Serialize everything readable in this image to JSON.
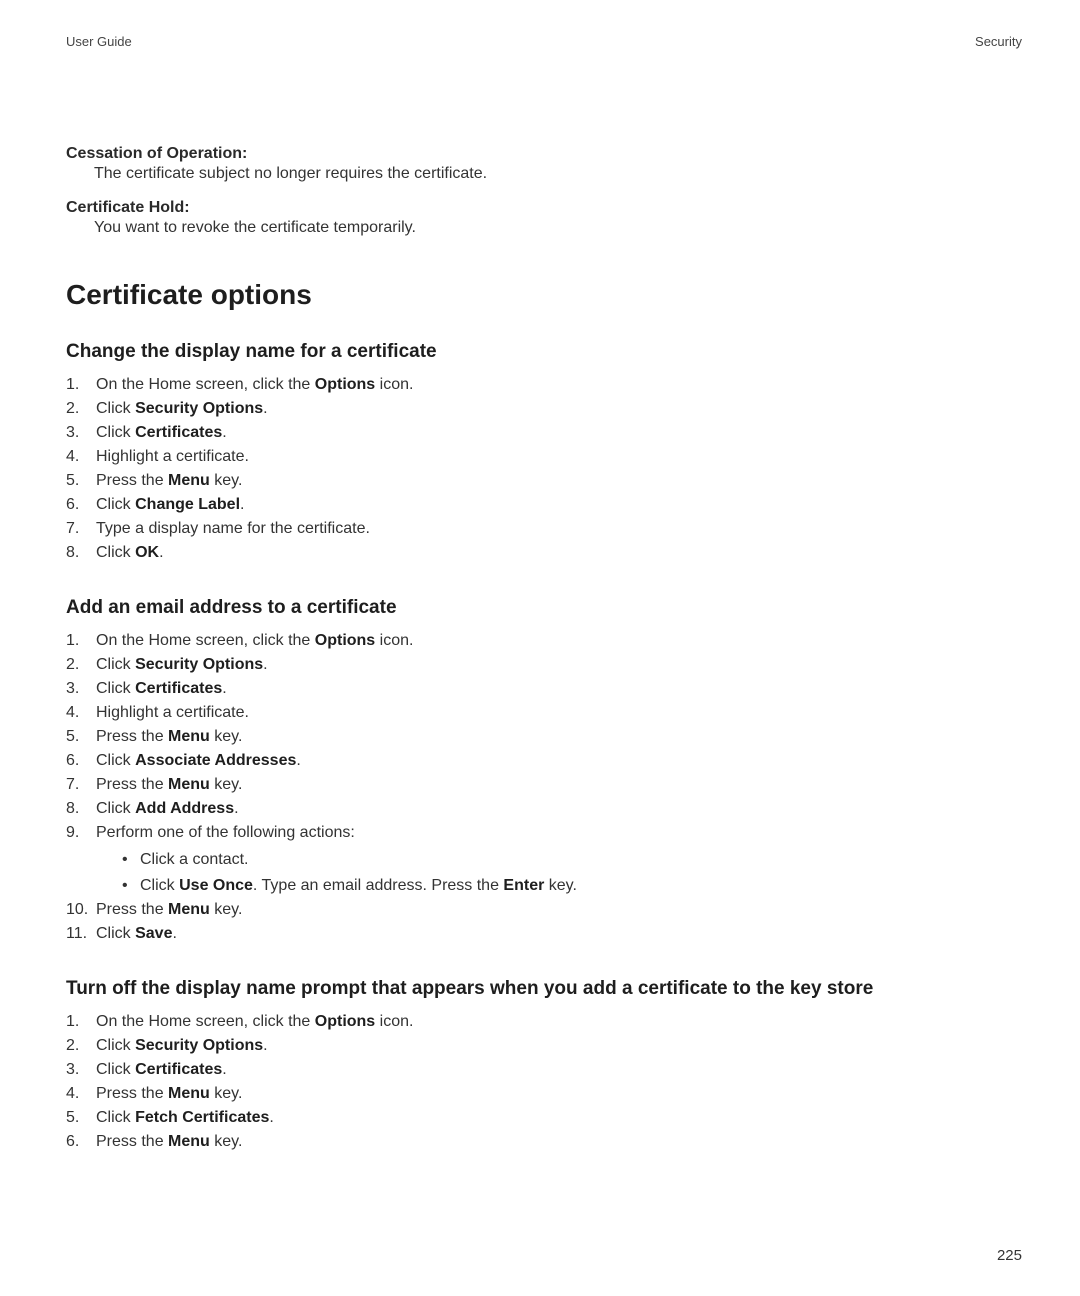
{
  "header": {
    "left": "User Guide",
    "right": "Security"
  },
  "definitions": [
    {
      "term": "Cessation of Operation:",
      "desc": "The certificate subject no longer requires the certificate."
    },
    {
      "term": "Certificate Hold:",
      "desc": "You want to revoke the certificate temporarily."
    }
  ],
  "section_title": "Certificate options",
  "subsections": [
    {
      "title": "Change the display name for a certificate",
      "steps": [
        [
          {
            "t": "plain",
            "v": "On the Home screen, click the "
          },
          {
            "t": "bold",
            "v": "Options"
          },
          {
            "t": "plain",
            "v": " icon."
          }
        ],
        [
          {
            "t": "plain",
            "v": "Click "
          },
          {
            "t": "bold",
            "v": "Security Options"
          },
          {
            "t": "plain",
            "v": "."
          }
        ],
        [
          {
            "t": "plain",
            "v": "Click "
          },
          {
            "t": "bold",
            "v": "Certificates"
          },
          {
            "t": "plain",
            "v": "."
          }
        ],
        [
          {
            "t": "plain",
            "v": "Highlight a certificate."
          }
        ],
        [
          {
            "t": "plain",
            "v": "Press the "
          },
          {
            "t": "bold",
            "v": "Menu"
          },
          {
            "t": "plain",
            "v": " key."
          }
        ],
        [
          {
            "t": "plain",
            "v": "Click "
          },
          {
            "t": "bold",
            "v": "Change Label"
          },
          {
            "t": "plain",
            "v": "."
          }
        ],
        [
          {
            "t": "plain",
            "v": "Type a display name for the certificate."
          }
        ],
        [
          {
            "t": "plain",
            "v": "Click "
          },
          {
            "t": "bold",
            "v": "OK"
          },
          {
            "t": "plain",
            "v": "."
          }
        ]
      ]
    },
    {
      "title": "Add an email address to a certificate",
      "steps": [
        [
          {
            "t": "plain",
            "v": "On the Home screen, click the "
          },
          {
            "t": "bold",
            "v": "Options"
          },
          {
            "t": "plain",
            "v": " icon."
          }
        ],
        [
          {
            "t": "plain",
            "v": "Click "
          },
          {
            "t": "bold",
            "v": "Security Options"
          },
          {
            "t": "plain",
            "v": "."
          }
        ],
        [
          {
            "t": "plain",
            "v": "Click "
          },
          {
            "t": "bold",
            "v": "Certificates"
          },
          {
            "t": "plain",
            "v": "."
          }
        ],
        [
          {
            "t": "plain",
            "v": "Highlight a certificate."
          }
        ],
        [
          {
            "t": "plain",
            "v": "Press the "
          },
          {
            "t": "bold",
            "v": "Menu"
          },
          {
            "t": "plain",
            "v": " key."
          }
        ],
        [
          {
            "t": "plain",
            "v": "Click "
          },
          {
            "t": "bold",
            "v": "Associate Addresses"
          },
          {
            "t": "plain",
            "v": "."
          }
        ],
        [
          {
            "t": "plain",
            "v": "Press the "
          },
          {
            "t": "bold",
            "v": "Menu"
          },
          {
            "t": "plain",
            "v": " key."
          }
        ],
        [
          {
            "t": "plain",
            "v": "Click "
          },
          {
            "t": "bold",
            "v": "Add Address"
          },
          {
            "t": "plain",
            "v": "."
          }
        ],
        {
          "intro": [
            {
              "t": "plain",
              "v": "Perform one of the following actions:"
            }
          ],
          "sub": [
            [
              {
                "t": "plain",
                "v": "Click a contact."
              }
            ],
            [
              {
                "t": "plain",
                "v": "Click "
              },
              {
                "t": "bold",
                "v": "Use Once"
              },
              {
                "t": "plain",
                "v": ". Type an email address. Press the "
              },
              {
                "t": "bold",
                "v": "Enter"
              },
              {
                "t": "plain",
                "v": " key."
              }
            ]
          ]
        },
        [
          {
            "t": "plain",
            "v": "Press the "
          },
          {
            "t": "bold",
            "v": "Menu"
          },
          {
            "t": "plain",
            "v": " key."
          }
        ],
        [
          {
            "t": "plain",
            "v": "Click "
          },
          {
            "t": "bold",
            "v": "Save"
          },
          {
            "t": "plain",
            "v": "."
          }
        ]
      ]
    },
    {
      "title": "Turn off the display name prompt that appears when you add a certificate to the key store",
      "steps": [
        [
          {
            "t": "plain",
            "v": "On the Home screen, click the "
          },
          {
            "t": "bold",
            "v": "Options"
          },
          {
            "t": "plain",
            "v": " icon."
          }
        ],
        [
          {
            "t": "plain",
            "v": "Click "
          },
          {
            "t": "bold",
            "v": "Security Options"
          },
          {
            "t": "plain",
            "v": "."
          }
        ],
        [
          {
            "t": "plain",
            "v": "Click "
          },
          {
            "t": "bold",
            "v": "Certificates"
          },
          {
            "t": "plain",
            "v": "."
          }
        ],
        [
          {
            "t": "plain",
            "v": "Press the "
          },
          {
            "t": "bold",
            "v": "Menu"
          },
          {
            "t": "plain",
            "v": " key."
          }
        ],
        [
          {
            "t": "plain",
            "v": "Click "
          },
          {
            "t": "bold",
            "v": "Fetch Certificates"
          },
          {
            "t": "plain",
            "v": "."
          }
        ],
        [
          {
            "t": "plain",
            "v": "Press the "
          },
          {
            "t": "bold",
            "v": "Menu"
          },
          {
            "t": "plain",
            "v": " key."
          }
        ]
      ]
    }
  ],
  "page_number": "225"
}
